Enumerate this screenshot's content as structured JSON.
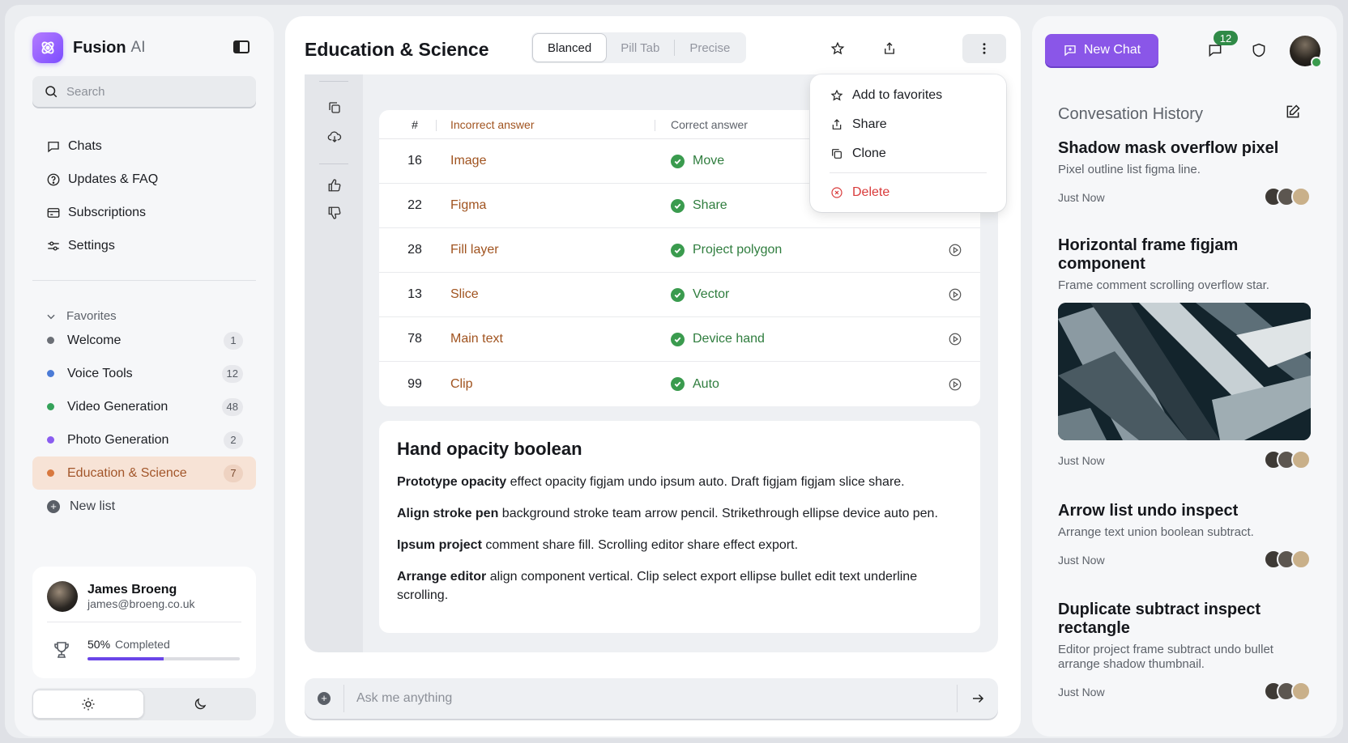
{
  "sidebar": {
    "brand": "Fusion",
    "brand_sub": "AI",
    "search_placeholder": "Search",
    "nav": [
      {
        "label": "Chats",
        "icon": "chat-bubble-icon"
      },
      {
        "label": "Updates & FAQ",
        "icon": "question-circle-icon"
      },
      {
        "label": "Subscriptions",
        "icon": "card-icon"
      },
      {
        "label": "Settings",
        "icon": "sliders-icon"
      }
    ],
    "favorites_label": "Favorites",
    "favorites": [
      {
        "label": "Welcome",
        "count": "1",
        "color": "#6b6f76"
      },
      {
        "label": "Voice Tools",
        "count": "12",
        "color": "#4b7bd6"
      },
      {
        "label": "Video Generation",
        "count": "48",
        "color": "#34a25a"
      },
      {
        "label": "Photo Generation",
        "count": "2",
        "color": "#8a5cf0"
      },
      {
        "label": "Education & Science",
        "count": "7",
        "color": "#d8783e"
      }
    ],
    "new_list_label": "New list",
    "user": {
      "name": "James Broeng",
      "email": "james@broeng.co.uk",
      "progress_percent": "50%",
      "progress_label": "Completed",
      "progress_value": 0.5
    }
  },
  "center": {
    "title": "Education & Science",
    "tabs": [
      "Blanced",
      "Pill Tab",
      "Precise"
    ],
    "table": {
      "headers": [
        "#",
        "Incorrect answer",
        "Correct answer"
      ],
      "rows": [
        {
          "num": "16",
          "incorrect": "Image",
          "correct": "Move"
        },
        {
          "num": "22",
          "incorrect": "Figma",
          "correct": "Share"
        },
        {
          "num": "28",
          "incorrect": "Fill layer",
          "correct": "Project polygon"
        },
        {
          "num": "13",
          "incorrect": "Slice",
          "correct": "Vector"
        },
        {
          "num": "78",
          "incorrect": "Main text",
          "correct": "Device hand"
        },
        {
          "num": "99",
          "incorrect": "Clip",
          "correct": "Auto"
        }
      ]
    },
    "article": {
      "heading": "Hand opacity boolean",
      "paragraphs": [
        {
          "bold": "Prototype opacity",
          "text": " effect opacity figjam undo ipsum auto. Draft figjam figjam slice share."
        },
        {
          "bold": "Align stroke pen",
          "text": " background stroke team arrow pencil. Strikethrough ellipse device auto pen."
        },
        {
          "bold": "Ipsum project",
          "text": " comment share fill. Scrolling editor share effect export."
        },
        {
          "bold": "Arrange editor",
          "text": " align component vertical. Clip select export ellipse bullet edit text underline scrolling."
        }
      ]
    },
    "prompt_placeholder": "Ask me anything",
    "menu": {
      "add_favorites": "Add to favorites",
      "share": "Share",
      "clone": "Clone",
      "delete": "Delete"
    }
  },
  "right": {
    "new_chat_label": "New Chat",
    "message_badge": "12",
    "history_title": "Convesation History",
    "history": [
      {
        "title": "Shadow mask overflow pixel",
        "desc": "Pixel outline list figma line.",
        "time": "Just Now"
      },
      {
        "title": "Horizontal frame figjam component",
        "desc": "Frame comment scrolling overflow star.",
        "time": "Just Now"
      },
      {
        "title": "Arrow list undo inspect",
        "desc": "Arrange text union boolean subtract.",
        "time": "Just Now"
      },
      {
        "title": "Duplicate subtract inspect rectangle",
        "desc": "Editor project frame subtract undo bullet arrange shadow thumbnail.",
        "time": "Just Now"
      }
    ]
  },
  "colors": {
    "accent": "#8a56e8",
    "success": "#3a9b4e",
    "danger": "#d93b3b",
    "incorrect": "#a0531f"
  }
}
